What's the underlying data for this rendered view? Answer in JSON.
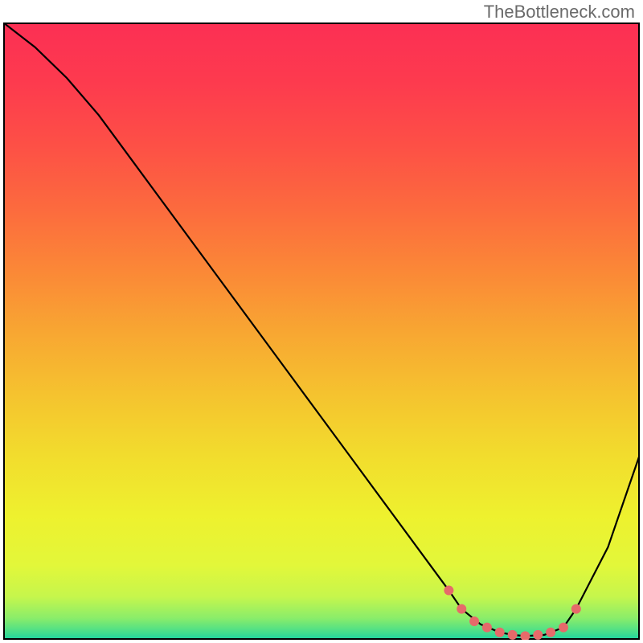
{
  "attribution": "TheBottleneck.com",
  "chart_data": {
    "type": "line",
    "title": "",
    "xlabel": "",
    "ylabel": "",
    "xlim": [
      0,
      100
    ],
    "ylim": [
      0,
      100
    ],
    "series": [
      {
        "name": "curve",
        "color": "#000000",
        "x": [
          0,
          5,
          10,
          15,
          20,
          25,
          30,
          35,
          40,
          45,
          50,
          55,
          60,
          65,
          70,
          72,
          75,
          78,
          80,
          82,
          85,
          88,
          90,
          95,
          100
        ],
        "y": [
          100,
          96,
          91,
          85,
          78,
          71,
          64,
          57,
          50,
          43,
          36,
          29,
          22,
          15,
          8,
          5,
          2.5,
          1.2,
          0.8,
          0.6,
          0.8,
          2,
          5,
          15,
          30
        ]
      }
    ],
    "markers": {
      "name": "highlight-dots",
      "color": "#e66a6a",
      "x": [
        70,
        72,
        74,
        76,
        78,
        80,
        82,
        84,
        86,
        88,
        90
      ],
      "y": [
        8,
        5,
        3,
        2,
        1.2,
        0.8,
        0.6,
        0.8,
        1.2,
        2,
        5
      ]
    },
    "gradient_stops": [
      {
        "offset": 0.0,
        "color": "#fc2f54"
      },
      {
        "offset": 0.1,
        "color": "#fd3b4e"
      },
      {
        "offset": 0.2,
        "color": "#fd5046"
      },
      {
        "offset": 0.3,
        "color": "#fc6a3e"
      },
      {
        "offset": 0.4,
        "color": "#fb8737"
      },
      {
        "offset": 0.5,
        "color": "#f8a632"
      },
      {
        "offset": 0.6,
        "color": "#f5c22f"
      },
      {
        "offset": 0.7,
        "color": "#f2dc2d"
      },
      {
        "offset": 0.8,
        "color": "#eef12e"
      },
      {
        "offset": 0.88,
        "color": "#e2f73a"
      },
      {
        "offset": 0.93,
        "color": "#c6f64c"
      },
      {
        "offset": 0.965,
        "color": "#8aed6a"
      },
      {
        "offset": 0.99,
        "color": "#3fdc8f"
      },
      {
        "offset": 1.0,
        "color": "#1bd3a3"
      }
    ]
  }
}
